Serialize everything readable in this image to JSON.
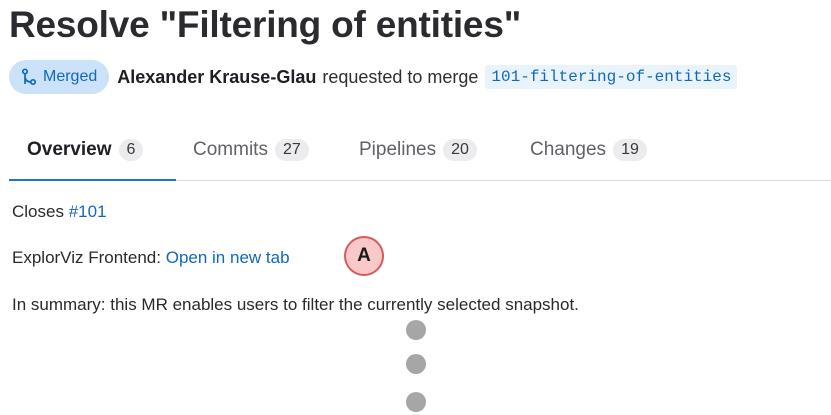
{
  "title": "Resolve \"Filtering of entities\"",
  "status_badge": {
    "label": "Merged",
    "icon": "merge-icon",
    "color": "#1068bf",
    "background": "#cbe2f9"
  },
  "author": "Alexander Krause-Glau",
  "request_text": "requested to merge",
  "branch": "101-filtering-of-entities",
  "tabs": [
    {
      "label": "Overview",
      "count": "6",
      "active": true
    },
    {
      "label": "Commits",
      "count": "27",
      "active": false
    },
    {
      "label": "Pipelines",
      "count": "20",
      "active": false
    },
    {
      "label": "Changes",
      "count": "19",
      "active": false
    }
  ],
  "description": {
    "closes_prefix": "Closes",
    "closes_link": "#101",
    "frontend_prefix": "ExplorViz Frontend:",
    "frontend_link": "Open in new tab",
    "summary": "In summary: this MR enables users to filter the currently selected snapshot."
  },
  "annotation_marker": {
    "label": "A",
    "fill": "#f9c9c9",
    "border": "#d35c5c"
  },
  "accent_color": "#1f75cb"
}
